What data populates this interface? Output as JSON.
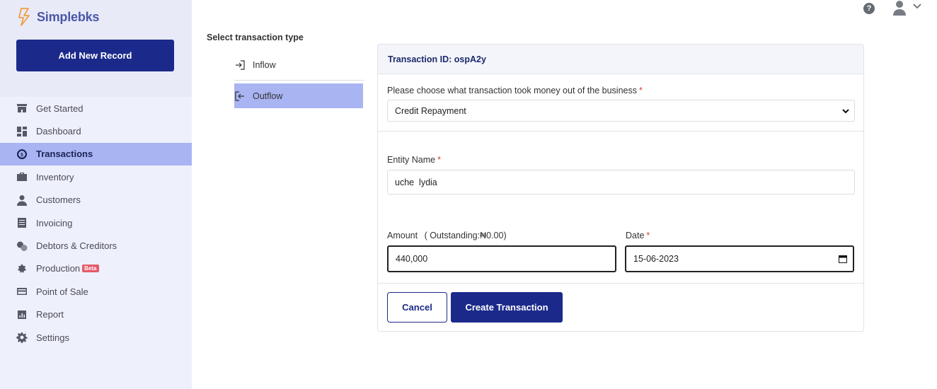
{
  "app": {
    "brand_name": "Simplebks",
    "add_new_record_label": "Add New Record"
  },
  "sidebar": {
    "items": [
      {
        "label": "Get Started",
        "icon": "store-icon",
        "active": false
      },
      {
        "label": "Dashboard",
        "icon": "dashboard-icon",
        "active": false
      },
      {
        "label": "Transactions",
        "icon": "transactions-icon",
        "active": true
      },
      {
        "label": "Inventory",
        "icon": "briefcase-icon",
        "active": false
      },
      {
        "label": "Customers",
        "icon": "person-icon",
        "active": false
      },
      {
        "label": "Invoicing",
        "icon": "receipt-icon",
        "active": false
      },
      {
        "label": "Debtors & Creditors",
        "icon": "debtors-icon",
        "active": false
      },
      {
        "label": "Production",
        "icon": "production-icon",
        "active": false,
        "badge": "Beta"
      },
      {
        "label": "Point of Sale",
        "icon": "card-icon",
        "active": false
      },
      {
        "label": "Report",
        "icon": "report-icon",
        "active": false
      },
      {
        "label": "Settings",
        "icon": "gear-icon",
        "active": false
      }
    ]
  },
  "header": {
    "help_glyph": "?"
  },
  "transaction_type": {
    "label": "Select transaction type",
    "options": [
      {
        "label": "Inflow",
        "icon": "sign-in-icon",
        "selected": false
      },
      {
        "label": "Outflow",
        "icon": "sign-out-icon",
        "selected": true
      }
    ]
  },
  "form": {
    "header": "Transaction ID: ospA2y",
    "transaction_question": "Please choose what transaction took money out of the business",
    "transaction_value": "Credit Repayment",
    "entity_label": "Entity Name",
    "entity_value": "uche  lydia",
    "amount_label": "Amount",
    "outstanding_text": "( Outstanding:₦0.00)",
    "amount_value": "440,000",
    "date_label": "Date",
    "date_value": "15-06-2023",
    "required_mark": "*",
    "cancel_label": "Cancel",
    "create_label": "Create Transaction"
  },
  "colors": {
    "primary": "#1b2a8a",
    "active_bg": "#a9b4f2",
    "sidebar_bg": "#eef0fb",
    "required": "#d93a3a",
    "beta_badge": "#e45a6a"
  }
}
